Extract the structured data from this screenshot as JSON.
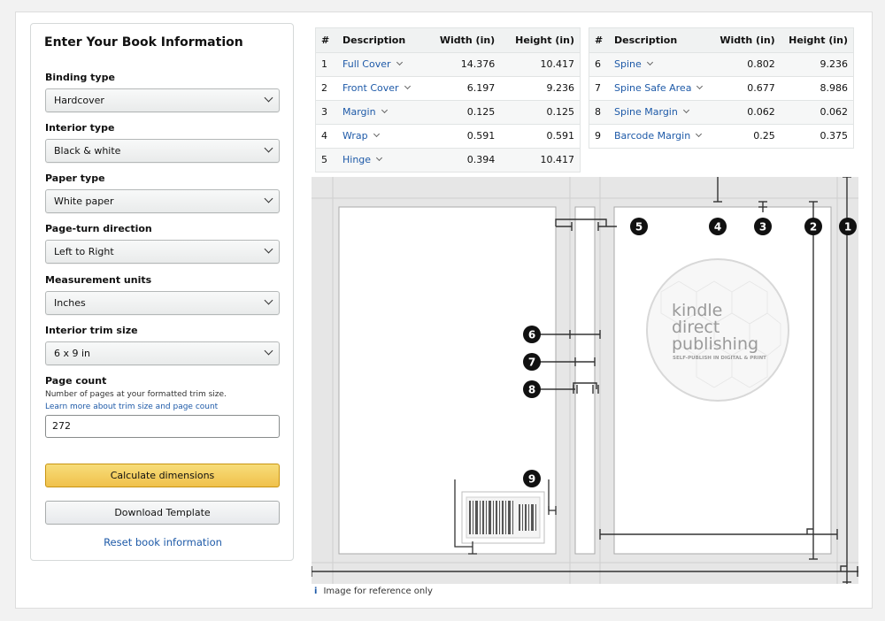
{
  "form": {
    "title": "Enter Your Book Information",
    "binding_label": "Binding type",
    "binding_value": "Hardcover",
    "interior_label": "Interior type",
    "interior_value": "Black & white",
    "paper_label": "Paper type",
    "paper_value": "White paper",
    "direction_label": "Page-turn direction",
    "direction_value": "Left to Right",
    "units_label": "Measurement units",
    "units_value": "Inches",
    "trim_label": "Interior trim size",
    "trim_value": "6 x 9 in",
    "page_count_label": "Page count",
    "page_count_hint": "Number of pages at your formatted trim size.",
    "page_count_link": "Learn more about trim size and page count",
    "page_count_value": "272",
    "calculate_label": "Calculate dimensions",
    "download_label": "Download Template",
    "reset_label": "Reset book information"
  },
  "table_headers": {
    "num": "#",
    "desc": "Description",
    "width": "Width (in)",
    "height": "Height (in)"
  },
  "table_left": [
    {
      "n": "1",
      "desc": "Full Cover",
      "w": "14.376",
      "h": "10.417"
    },
    {
      "n": "2",
      "desc": "Front Cover",
      "w": "6.197",
      "h": "9.236"
    },
    {
      "n": "3",
      "desc": "Margin",
      "w": "0.125",
      "h": "0.125"
    },
    {
      "n": "4",
      "desc": "Wrap",
      "w": "0.591",
      "h": "0.591"
    },
    {
      "n": "5",
      "desc": "Hinge",
      "w": "0.394",
      "h": "10.417"
    }
  ],
  "table_right": [
    {
      "n": "6",
      "desc": "Spine",
      "w": "0.802",
      "h": "9.236"
    },
    {
      "n": "7",
      "desc": "Spine Safe Area",
      "w": "0.677",
      "h": "8.986"
    },
    {
      "n": "8",
      "desc": "Spine Margin",
      "w": "0.062",
      "h": "0.062"
    },
    {
      "n": "9",
      "desc": "Barcode Margin",
      "w": "0.25",
      "h": "0.375"
    }
  ],
  "diagram": {
    "logo_line1": "kindle",
    "logo_line2": "direct",
    "logo_line3": "publishing",
    "logo_tagline": "SELF-PUBLISH IN DIGITAL & PRINT",
    "markers": [
      "1",
      "2",
      "3",
      "4",
      "5",
      "6",
      "7",
      "8",
      "9"
    ]
  },
  "ref_icon": "i",
  "ref_note": "Image for reference only"
}
